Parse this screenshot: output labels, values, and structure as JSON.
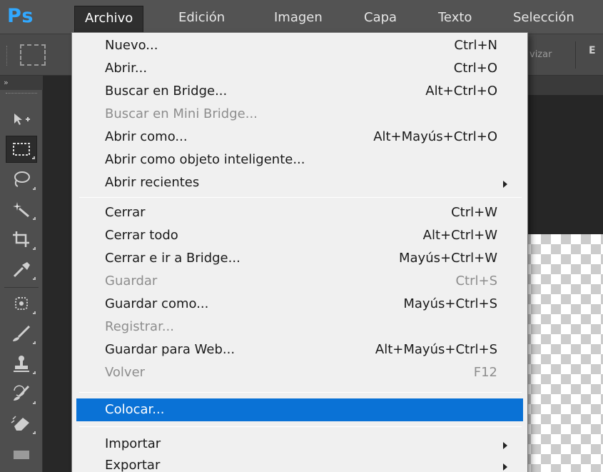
{
  "app": {
    "logo": "Ps"
  },
  "menubar": {
    "items": [
      "Archivo",
      "Edición",
      "Imagen",
      "Capa",
      "Texto",
      "Selección"
    ]
  },
  "optionsbar": {
    "partial_button": "vizar",
    "partial_letter": "E"
  },
  "toolbox": {
    "collapse_glyph": "»"
  },
  "dropdown": {
    "items": [
      {
        "label": "Nuevo...",
        "shortcut": "Ctrl+N",
        "enabled": true
      },
      {
        "label": "Abrir...",
        "shortcut": "Ctrl+O",
        "enabled": true
      },
      {
        "label": "Buscar en Bridge...",
        "shortcut": "Alt+Ctrl+O",
        "enabled": true
      },
      {
        "label": "Buscar en Mini Bridge...",
        "shortcut": "",
        "enabled": false
      },
      {
        "label": "Abrir como...",
        "shortcut": "Alt+Mayús+Ctrl+O",
        "enabled": true
      },
      {
        "label": "Abrir como objeto inteligente...",
        "shortcut": "",
        "enabled": true
      },
      {
        "label": "Abrir recientes",
        "shortcut": "",
        "enabled": true,
        "submenu": true
      },
      {
        "label": "Cerrar",
        "shortcut": "Ctrl+W",
        "enabled": true
      },
      {
        "label": "Cerrar todo",
        "shortcut": "Alt+Ctrl+W",
        "enabled": true
      },
      {
        "label": "Cerrar e ir a Bridge...",
        "shortcut": "Mayús+Ctrl+W",
        "enabled": true
      },
      {
        "label": "Guardar",
        "shortcut": "Ctrl+S",
        "enabled": false
      },
      {
        "label": "Guardar como...",
        "shortcut": "Mayús+Ctrl+S",
        "enabled": true
      },
      {
        "label": "Registrar...",
        "shortcut": "",
        "enabled": false
      },
      {
        "label": "Guardar para Web...",
        "shortcut": "Alt+Mayús+Ctrl+S",
        "enabled": true
      },
      {
        "label": "Volver",
        "shortcut": "F12",
        "enabled": false
      },
      {
        "label": "Colocar...",
        "shortcut": "",
        "enabled": true,
        "highlighted": true
      },
      {
        "label": "Importar",
        "shortcut": "",
        "enabled": true,
        "submenu": true
      },
      {
        "label": "Exportar",
        "shortcut": "",
        "enabled": true,
        "submenu": true
      }
    ]
  },
  "colors": {
    "highlight": "#0a72d6",
    "logo": "#31a8ff",
    "menubar": "#535353",
    "menu_bg": "#f0f0f0"
  }
}
